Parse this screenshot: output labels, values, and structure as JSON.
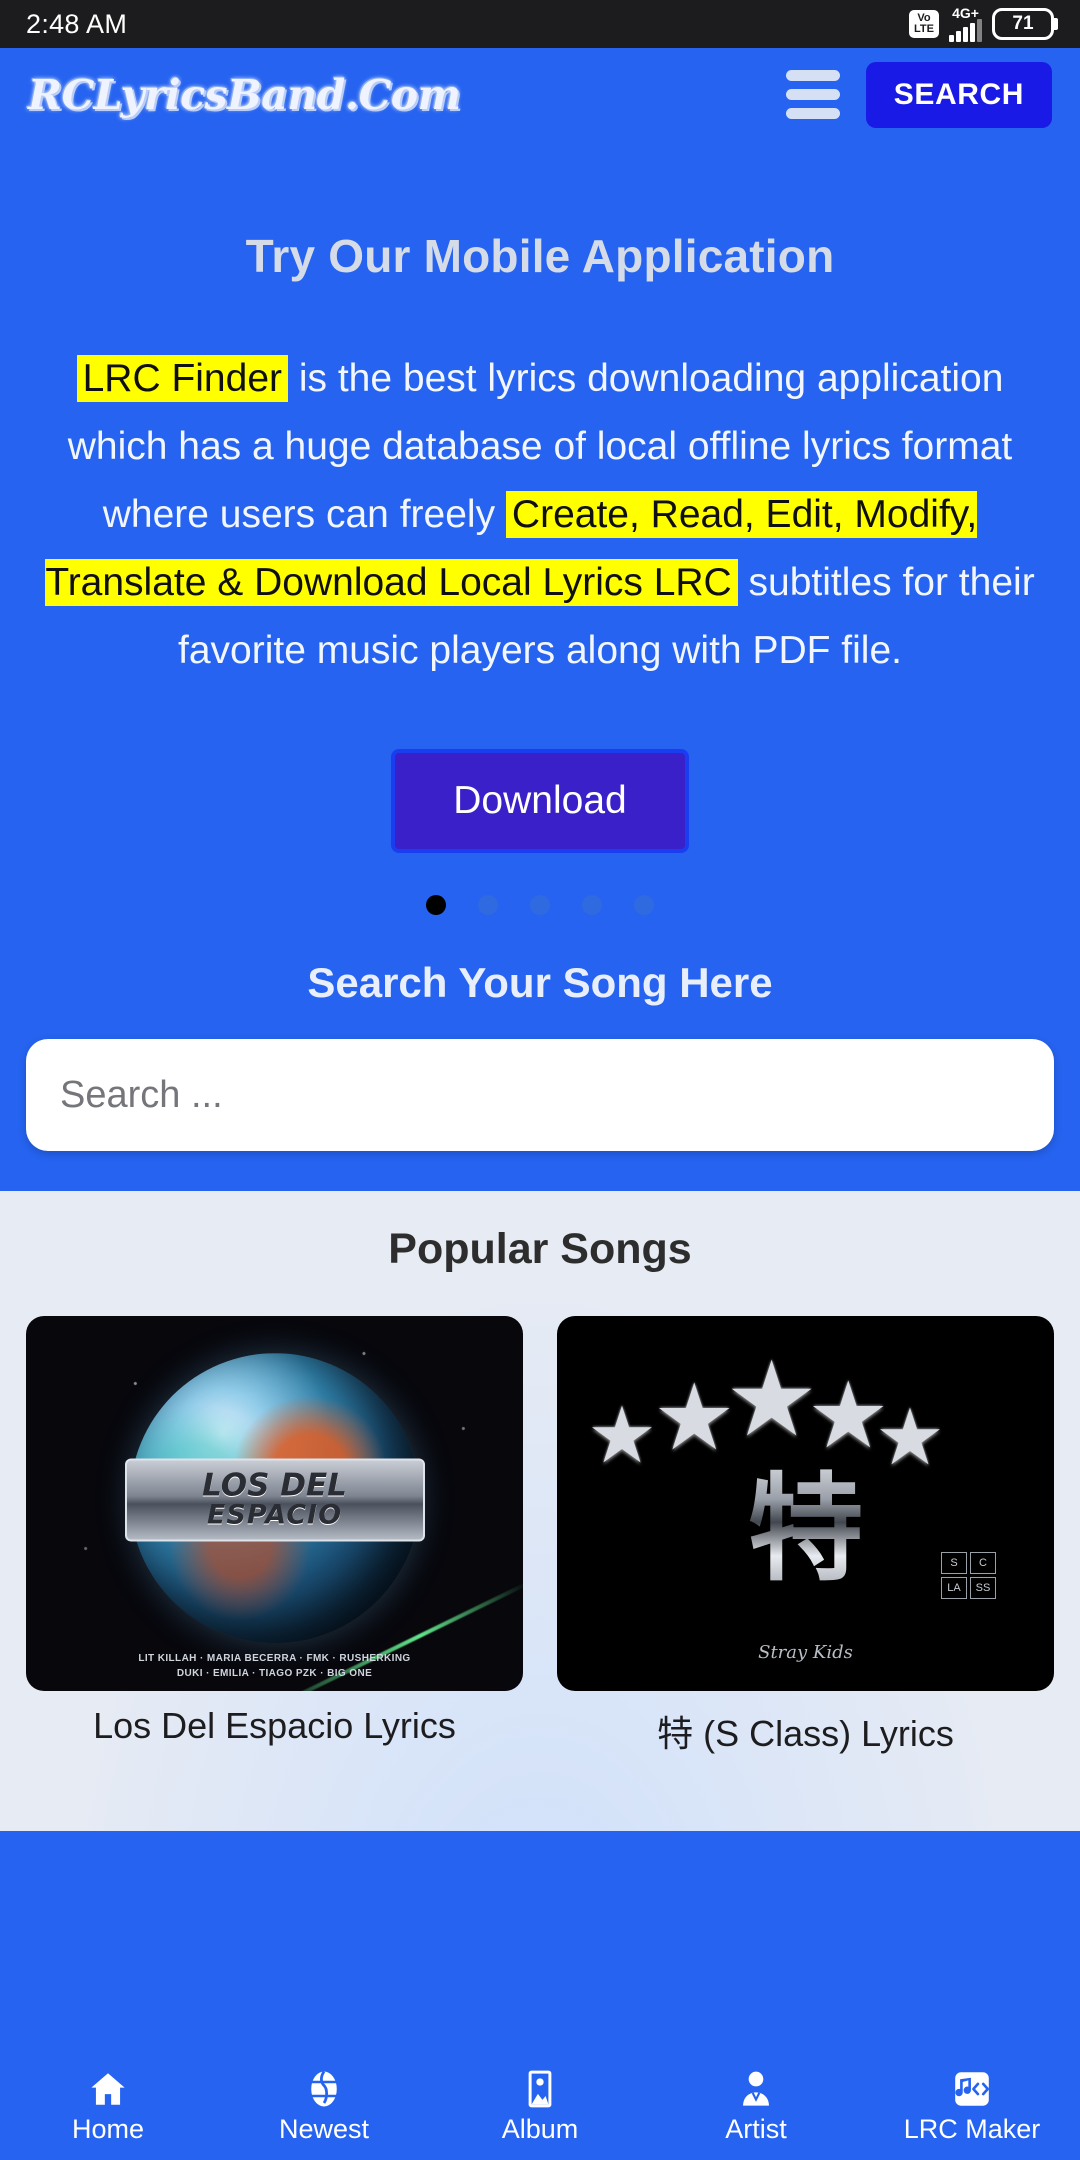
{
  "status_bar": {
    "time": "2:48 AM",
    "volte_top": "Vo",
    "volte_bottom": "LTE",
    "network": "4G+",
    "battery": "71"
  },
  "header": {
    "logo": "RCLyricsBand.Com",
    "menu_icon": "hamburger-icon",
    "search_label": "SEARCH"
  },
  "hero": {
    "title": "Try Our Mobile Application",
    "paragraph": {
      "part1_highlight": "LRC Finder",
      "part2": " is the best lyrics downloading application which has a huge database of local offline lyrics format where users can freely ",
      "part3_highlight": "Create, Read, Edit, Modify, Translate & Download Local Lyrics LRC",
      "part4": " subtitles for their favorite music players along with PDF file."
    },
    "download_label": "Download",
    "carousel": {
      "total": 5,
      "active_index": 0
    }
  },
  "search_section": {
    "title": "Search Your Song Here",
    "placeholder": "Search ...",
    "value": ""
  },
  "popular": {
    "title": "Popular Songs",
    "cards": [
      {
        "title": "Los Del Espacio Lyrics",
        "art_line1": "LOS DEL",
        "art_line2": "ESPACIO",
        "credits_line1": "LIT KILLAH  ·  MARIA BECERRA  ·  FMK  ·  RUSHERKING",
        "credits_line2": "DUKI  ·  EMILIA  ·  TIAGO PZK  ·  BIG ONE"
      },
      {
        "title": "特 (S Class) Lyrics",
        "art_glyph": "特",
        "art_box": [
          "S",
          "C",
          "LA",
          "SS"
        ],
        "signature": "Stray Kids"
      }
    ]
  },
  "bottom_nav": [
    {
      "label": "Home",
      "icon": "home-icon"
    },
    {
      "label": "Newest",
      "icon": "globe-icon"
    },
    {
      "label": "Album",
      "icon": "album-image-icon"
    },
    {
      "label": "Artist",
      "icon": "person-icon"
    },
    {
      "label": "LRC Maker",
      "icon": "music-code-icon"
    }
  ],
  "colors": {
    "brand_blue": "#2563f0",
    "search_button": "#1a1ae6",
    "download_button": "#3a20c8",
    "highlight_yellow": "#ffff00",
    "popular_bg": "#e6ebf4"
  }
}
